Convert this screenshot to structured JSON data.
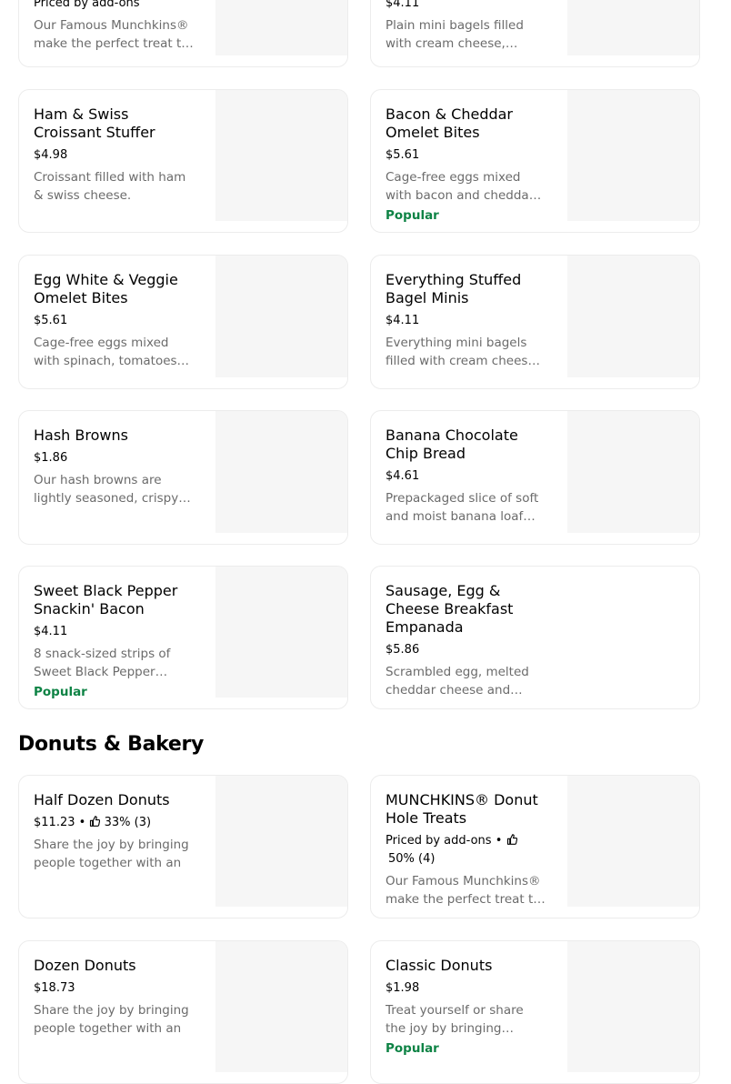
{
  "items": {
    "munchkins_top": {
      "meta": "Priced by add-ons",
      "desc": "Our Famous Munchkins® make the perfect treat to share"
    },
    "plain_bagel_minis": {
      "price": "$4.11",
      "desc": "Plain mini bagels filled with cream cheese, served warm"
    },
    "ham_swiss": {
      "title": "Ham & Swiss Croissant Stuffer",
      "price": "$4.98",
      "desc": "Croissant filled with ham & swiss cheese."
    },
    "bacon_cheddar": {
      "title": "Bacon & Cheddar Omelet Bites",
      "price": "$5.61",
      "desc": "Cage-free eggs mixed with bacon and cheddar cheese, sous vide",
      "badge": "Popular"
    },
    "egg_white_veggie": {
      "title": "Egg White & Veggie Omelet Bites",
      "price": "$5.61",
      "desc": "Cage-free eggs mixed with spinach, tomatoes and a blend"
    },
    "everything_bagel": {
      "title": "Everything Stuffed Bagel Minis",
      "price": "$4.11",
      "desc": "Everything mini bagels filled with cream cheese, served warm"
    },
    "hash_browns": {
      "title": "Hash Browns",
      "price": "$1.86",
      "desc": "Our hash browns are lightly seasoned, crispy bites of"
    },
    "banana_bread": {
      "title": "Banana Chocolate Chip Bread",
      "price": "$4.61",
      "desc": "Prepackaged slice of soft and moist banana loaf cake"
    },
    "snackin_bacon": {
      "title": "Sweet Black Pepper Snackin' Bacon",
      "price": "$4.11",
      "desc": "8 snack-sized strips of Sweet Black Pepper Bacon.",
      "badge": "Popular"
    },
    "empanada": {
      "title": "Sausage, Egg & Cheese Breakfast Empanada",
      "price": "$5.86",
      "desc": "Scrambled egg, melted cheddar cheese and savory sausage"
    }
  },
  "section": {
    "title": "Donuts & Bakery"
  },
  "donuts": {
    "half_dozen": {
      "title": "Half Dozen Donuts",
      "price": "$11.23",
      "sep": "•",
      "rating": "33% (3)",
      "desc": "Share the joy by bringing people together with an"
    },
    "munchkins": {
      "title": "MUNCHKINS® Donut Hole Treats",
      "meta": "Priced by add-ons",
      "sep": "•",
      "rating": "50% (4)",
      "desc": "Our Famous Munchkins® make the perfect treat to share"
    },
    "dozen": {
      "title": "Dozen Donuts",
      "price": "$18.73",
      "desc": "Share the joy by bringing people together with an"
    },
    "classic": {
      "title": "Classic Donuts",
      "price": "$1.98",
      "desc": "Treat yourself or share the joy by bringing people together",
      "badge": "Popular"
    }
  },
  "colors": {
    "popular": "#0e8345",
    "description": "#6b6b6b",
    "border": "#ececec",
    "thumbnail": "#f6f6f6"
  }
}
